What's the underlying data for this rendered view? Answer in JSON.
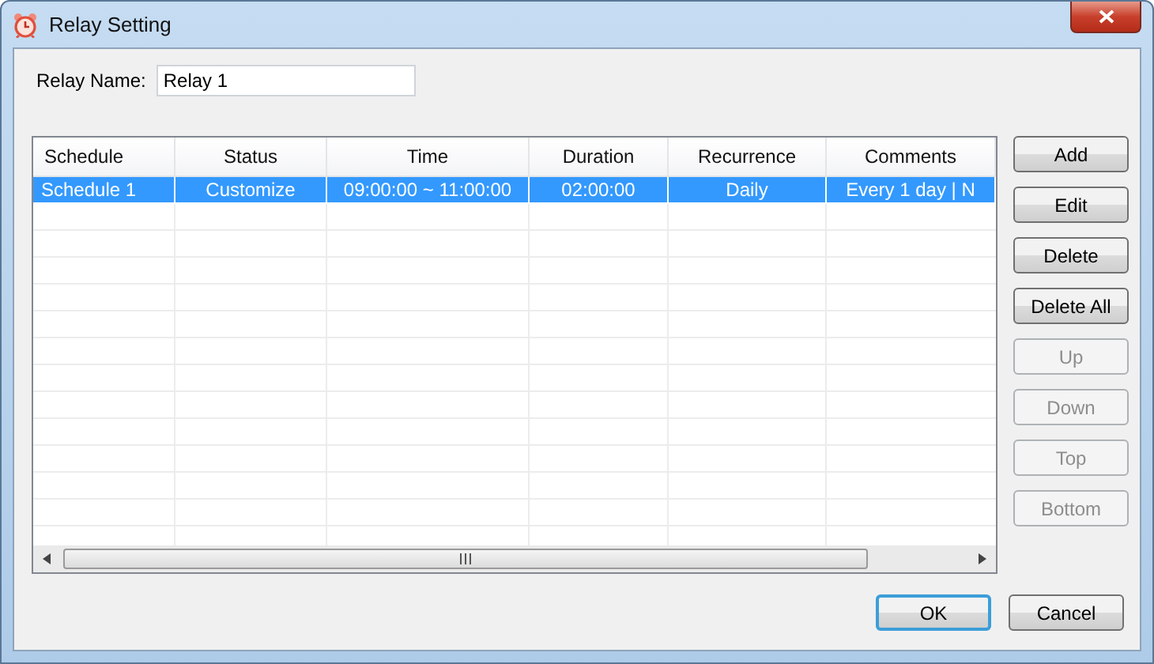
{
  "window": {
    "title": "Relay Setting"
  },
  "relay_name": {
    "label": "Relay Name:",
    "value": "Relay 1"
  },
  "table": {
    "columns": [
      "Schedule",
      "Status",
      "Time",
      "Duration",
      "Recurrence",
      "Comments"
    ],
    "rows": [
      {
        "cells": [
          "Schedule 1",
          "Customize",
          "09:00:00 ~ 11:00:00",
          "02:00:00",
          "Daily",
          "Every 1 day | N"
        ],
        "selected": true
      }
    ]
  },
  "side_buttons": [
    {
      "label": "Add",
      "disabled": false
    },
    {
      "label": "Edit",
      "disabled": false
    },
    {
      "label": "Delete",
      "disabled": false
    },
    {
      "label": "Delete All",
      "disabled": false
    },
    {
      "label": "Up",
      "disabled": true
    },
    {
      "label": "Down",
      "disabled": true
    },
    {
      "label": "Top",
      "disabled": true
    },
    {
      "label": "Bottom",
      "disabled": true
    }
  ],
  "footer_buttons": [
    {
      "label": "OK",
      "default": true
    },
    {
      "label": "Cancel",
      "default": false
    }
  ]
}
